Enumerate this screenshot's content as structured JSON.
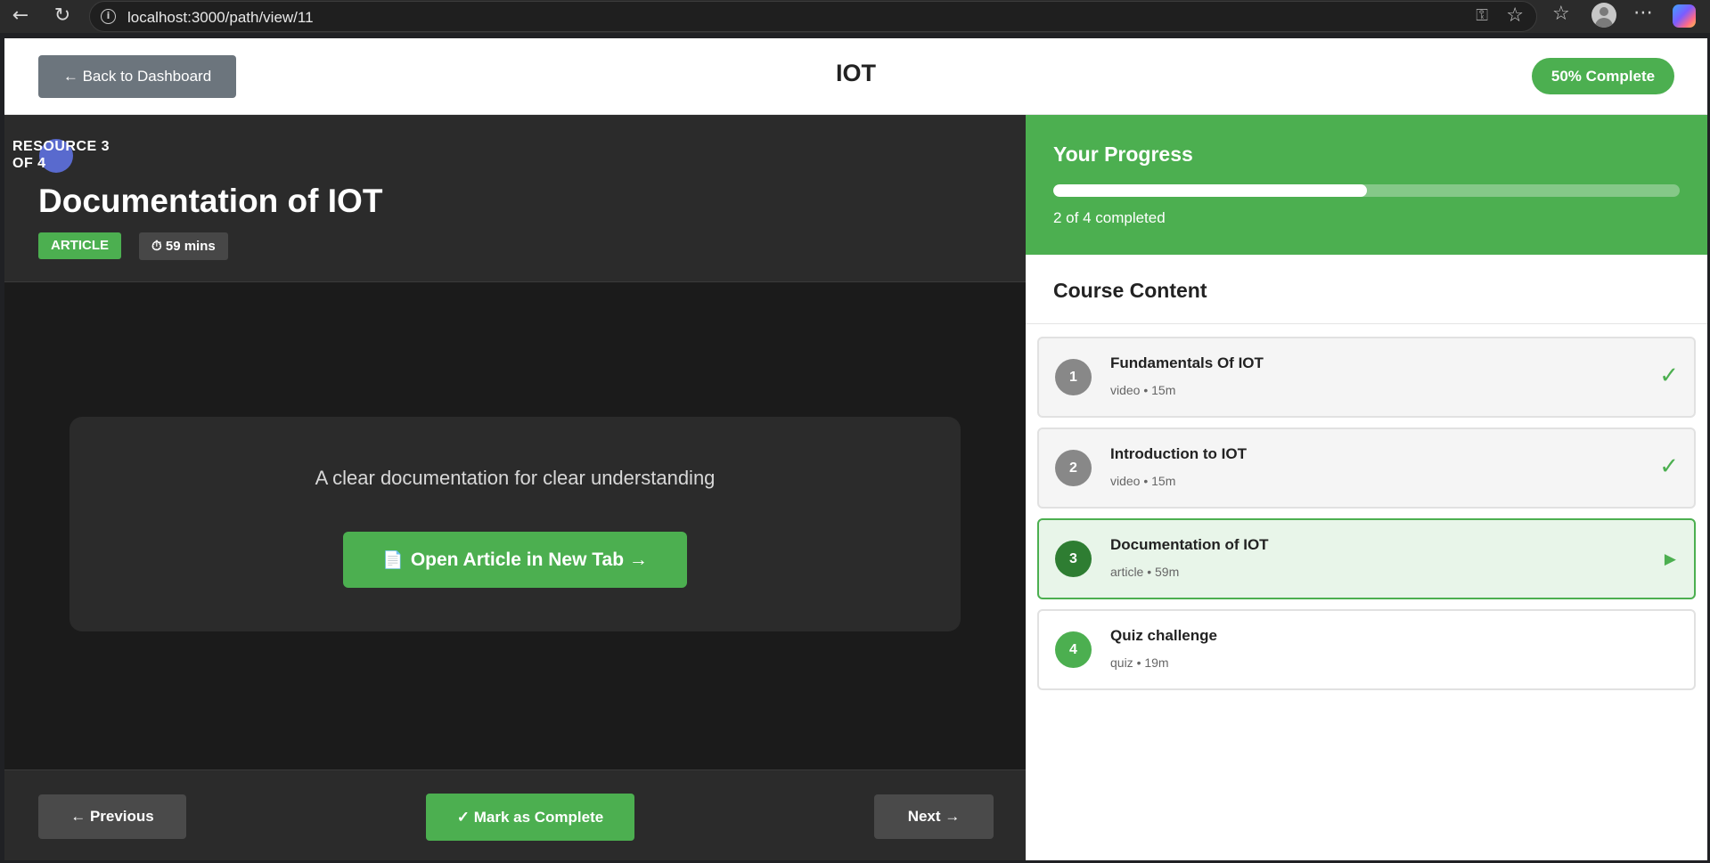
{
  "browser": {
    "url": "localhost:3000/path/view/11"
  },
  "header": {
    "back_label": "← Back to Dashboard",
    "title": "IOT",
    "completion_badge": "50% Complete"
  },
  "resource": {
    "counter": "RESOURCE 3 OF 4",
    "title": "Documentation of IOT",
    "type_tag": "ARTICLE",
    "duration_tag": "⏱ 59 mins",
    "description": "A clear documentation for clear understanding",
    "open_label": "Open Article in New Tab →",
    "open_icon": "📄"
  },
  "footer": {
    "previous_label": "← Previous",
    "mark_complete_label": "✓ Mark as Complete",
    "next_label": "Next →"
  },
  "progress": {
    "title": "Your Progress",
    "fraction": 0.5,
    "text": "2 of 4 completed"
  },
  "course_content": {
    "title": "Course Content",
    "items": [
      {
        "number": "1",
        "title": "Fundamentals Of IOT",
        "meta": "video • 15m",
        "status": "✓"
      },
      {
        "number": "2",
        "title": "Introduction to IOT",
        "meta": "video • 15m",
        "status": "✓"
      },
      {
        "number": "3",
        "title": "Documentation of IOT",
        "meta": "article • 59m",
        "status": "▶"
      },
      {
        "number": "4",
        "title": "Quiz challenge",
        "meta": "quiz • 19m",
        "status": ""
      }
    ]
  },
  "colors": {
    "accent": "#4caf50",
    "current_item_bg": "#e8f5e9",
    "dark_bg": "#1b1b1b",
    "panel_bg": "#2b2b2b",
    "secondary_button": "#6c757d"
  }
}
